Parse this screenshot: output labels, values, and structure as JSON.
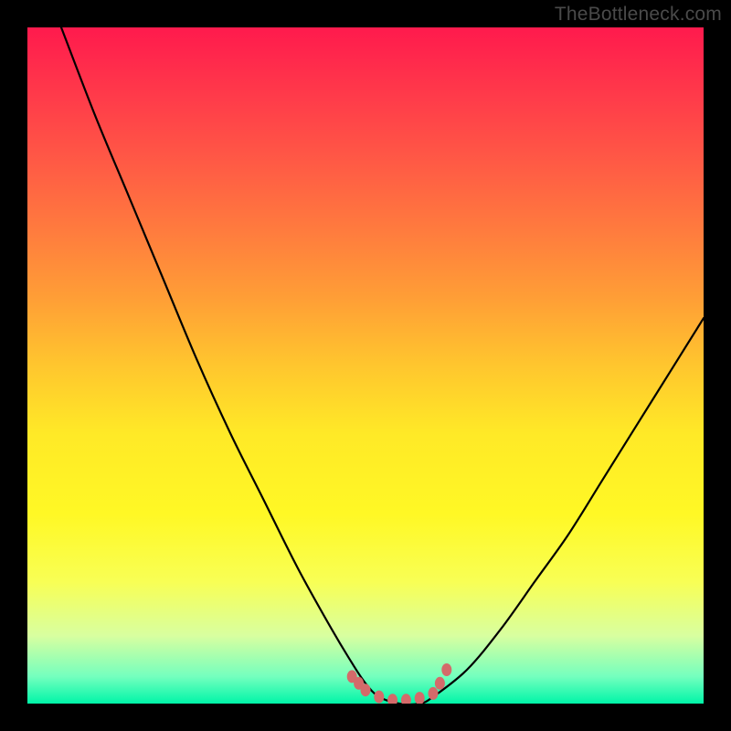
{
  "attribution": "TheBottleneck.com",
  "colors": {
    "frame": "#000000",
    "gradient_top": "#ff1a4d",
    "gradient_bottom": "#00f5a8",
    "curve": "#000000",
    "marker": "#d46a6a"
  },
  "chart_data": {
    "type": "line",
    "title": "",
    "xlabel": "",
    "ylabel": "",
    "xlim": [
      0,
      100
    ],
    "ylim": [
      0,
      100
    ],
    "series": [
      {
        "name": "curve",
        "x": [
          5,
          10,
          15,
          20,
          25,
          30,
          35,
          40,
          45,
          48,
          50,
          52,
          55,
          58,
          60,
          65,
          70,
          75,
          80,
          85,
          90,
          95,
          100
        ],
        "y": [
          100,
          87,
          75,
          63,
          51,
          40,
          30,
          20,
          11,
          6,
          3,
          1,
          0,
          0,
          1,
          5,
          11,
          18,
          25,
          33,
          41,
          49,
          57
        ]
      }
    ],
    "markers": {
      "name": "highlight-points",
      "color": "#d46a6a",
      "x": [
        48,
        49,
        50,
        52,
        54,
        56,
        58,
        60,
        61,
        62
      ],
      "y": [
        4,
        3,
        2,
        1,
        0.5,
        0.5,
        0.8,
        1.5,
        3,
        5
      ]
    }
  }
}
